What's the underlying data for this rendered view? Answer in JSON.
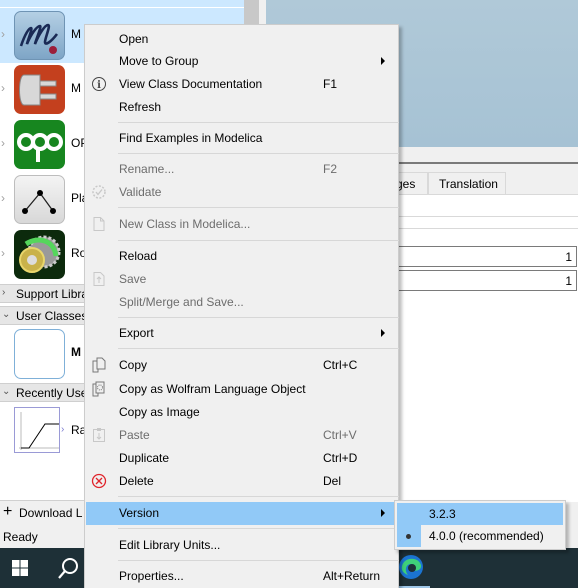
{
  "library_panel": {
    "items": [
      {
        "name": "M",
        "icon": "modelica-logo-icon",
        "selected": true
      },
      {
        "name": "M",
        "icon": "electrical-plug-icon",
        "selected": false
      },
      {
        "name": "OP",
        "icon": "opc-logo-icon",
        "selected": false
      },
      {
        "name": "Pla",
        "icon": "planar-mechanics-icon",
        "selected": false
      },
      {
        "name": "Ro",
        "icon": "rotational-gear-icon",
        "selected": false
      }
    ],
    "sections": {
      "support": "Support Libra",
      "user_classes": "User Classes",
      "recently_used": "Recently Use"
    },
    "user_class_item": {
      "name": "M"
    },
    "recent_item": {
      "name": "Ra"
    },
    "download_label": "Download L",
    "status": "Ready"
  },
  "right_panel": {
    "tabs": [
      {
        "label": "ges"
      },
      {
        "label": "Translation"
      }
    ],
    "fields": [
      {
        "value": "1"
      },
      {
        "value": "1"
      }
    ]
  },
  "context_menu": {
    "items": [
      {
        "label": "Open",
        "shortcut": "",
        "icon": "",
        "enabled": true,
        "submenu": false
      },
      {
        "label": "Move to Group",
        "shortcut": "",
        "icon": "",
        "enabled": true,
        "submenu": true
      },
      {
        "label": "View Class Documentation",
        "shortcut": "F1",
        "icon": "info-icon",
        "enabled": true,
        "submenu": false
      },
      {
        "label": "Refresh",
        "shortcut": "",
        "icon": "",
        "enabled": true,
        "submenu": false
      },
      {
        "label": "Find Examples in Modelica",
        "shortcut": "",
        "icon": "",
        "enabled": true,
        "submenu": false
      },
      {
        "label": "Rename...",
        "shortcut": "F2",
        "icon": "",
        "enabled": false,
        "submenu": false
      },
      {
        "label": "Validate",
        "shortcut": "",
        "icon": "validate-icon",
        "enabled": false,
        "submenu": false
      },
      {
        "label": "New Class in Modelica...",
        "shortcut": "",
        "icon": "new-document-icon",
        "enabled": false,
        "submenu": false
      },
      {
        "label": "Reload",
        "shortcut": "",
        "icon": "",
        "enabled": true,
        "submenu": false
      },
      {
        "label": "Save",
        "shortcut": "",
        "icon": "save-icon",
        "enabled": false,
        "submenu": false
      },
      {
        "label": "Split/Merge and Save...",
        "shortcut": "",
        "icon": "",
        "enabled": false,
        "submenu": false
      },
      {
        "label": "Export",
        "shortcut": "",
        "icon": "",
        "enabled": true,
        "submenu": true
      },
      {
        "label": "Copy",
        "shortcut": "Ctrl+C",
        "icon": "copy-icon",
        "enabled": true,
        "submenu": false
      },
      {
        "label": "Copy as Wolfram Language Object",
        "shortcut": "",
        "icon": "copy-wolfram-icon",
        "enabled": true,
        "submenu": false
      },
      {
        "label": "Copy as Image",
        "shortcut": "",
        "icon": "",
        "enabled": true,
        "submenu": false
      },
      {
        "label": "Paste",
        "shortcut": "Ctrl+V",
        "icon": "paste-icon",
        "enabled": false,
        "submenu": false
      },
      {
        "label": "Duplicate",
        "shortcut": "Ctrl+D",
        "icon": "",
        "enabled": true,
        "submenu": false
      },
      {
        "label": "Delete",
        "shortcut": "Del",
        "icon": "delete-icon",
        "enabled": true,
        "submenu": false
      },
      {
        "label": "Version",
        "shortcut": "",
        "icon": "",
        "enabled": true,
        "submenu": true,
        "active": true
      },
      {
        "label": "Edit Library Units...",
        "shortcut": "",
        "icon": "",
        "enabled": true,
        "submenu": false
      },
      {
        "label": "Properties...",
        "shortcut": "Alt+Return",
        "icon": "",
        "enabled": true,
        "submenu": false
      }
    ]
  },
  "version_submenu": {
    "items": [
      {
        "label": "3.2.3",
        "checked": false,
        "highlighted": true
      },
      {
        "label": "4.0.0 (recommended)",
        "checked": true,
        "highlighted": false
      }
    ]
  },
  "colors": {
    "highlight": "#91c9f7",
    "selection": "#cce8ff",
    "taskbar": "#1e3037",
    "delete_red": "#e0242b"
  }
}
